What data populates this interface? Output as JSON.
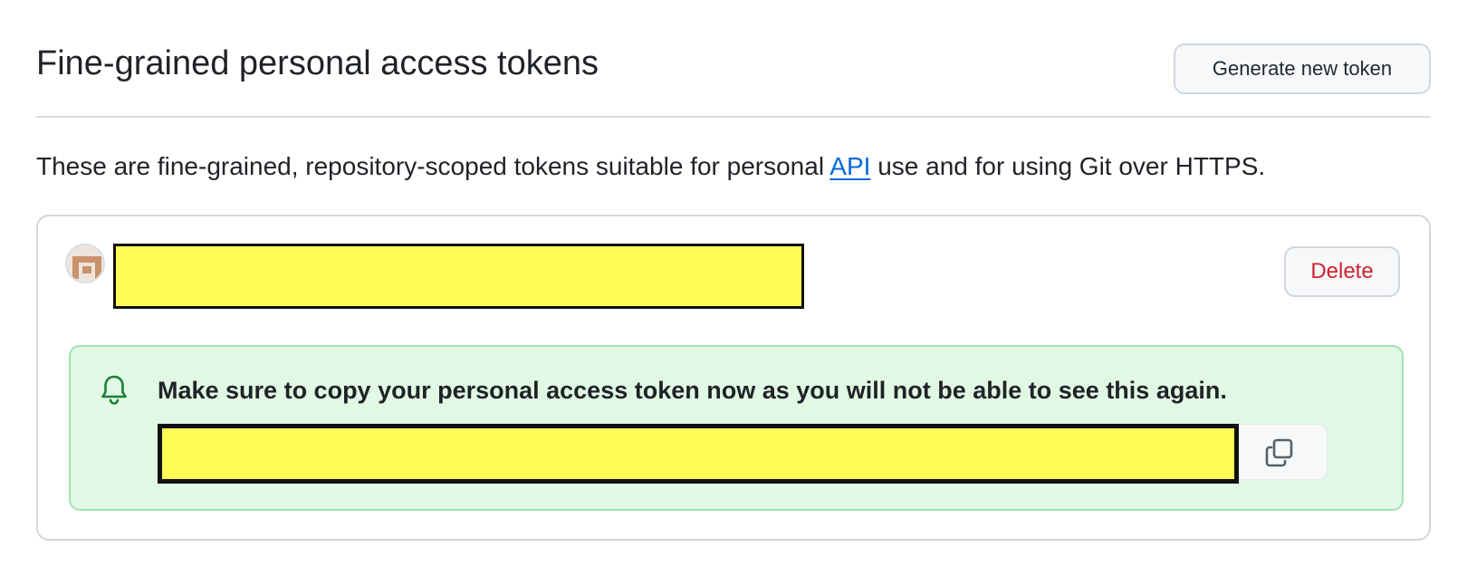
{
  "header": {
    "title": "Fine-grained personal access tokens",
    "generate_label": "Generate new token"
  },
  "description": {
    "before_link": "These are fine-grained, repository-scoped tokens suitable for personal ",
    "link_text": "API",
    "after_link": " use and for using Git over HTTPS."
  },
  "token": {
    "name_redacted": "",
    "delete_label": "Delete",
    "value_redacted": "",
    "avatar_icon": "identicon-avatar",
    "copy_icon": "copy-icon"
  },
  "flash": {
    "icon": "bell-icon",
    "message": "Make sure to copy your personal access token now as you will not be able to see this again."
  },
  "colors": {
    "link": "#0969da",
    "danger": "#cf222e",
    "success_bg": "#e1f8e4",
    "success_border": "#a3e2b2",
    "redaction": "#fefc55"
  }
}
